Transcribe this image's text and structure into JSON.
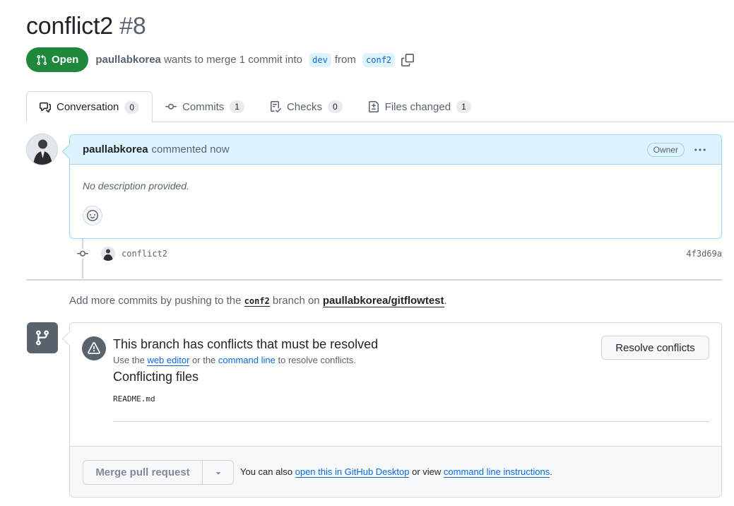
{
  "pr": {
    "title": "conflict2",
    "number": "#8",
    "state": "Open",
    "author": "paullabkorea",
    "merge_text_before": "wants to merge 1 commit into",
    "base_branch": "dev",
    "from_text": "from",
    "head_branch": "conf2"
  },
  "tabs": [
    {
      "label": "Conversation",
      "count": "0",
      "icon": "comment-discussion-icon"
    },
    {
      "label": "Commits",
      "count": "1",
      "icon": "git-commit-icon"
    },
    {
      "label": "Checks",
      "count": "0",
      "icon": "checklist-icon"
    },
    {
      "label": "Files changed",
      "count": "1",
      "icon": "file-diff-icon"
    }
  ],
  "comment": {
    "author": "paullabkorea",
    "action": "commented now",
    "role_badge": "Owner",
    "body": "No description provided."
  },
  "commit": {
    "message": "conflict2",
    "sha": "4f3d69a"
  },
  "push_hint": {
    "before": "Add more commits by pushing to the",
    "branch": "conf2",
    "middle": "branch on",
    "repo": "paullabkorea/gitflowtest",
    "end": "."
  },
  "merge_box": {
    "conflict_title": "This branch has conflicts that must be resolved",
    "sub_before": "Use the",
    "web_editor": "web editor",
    "sub_mid": "or the",
    "command_line": "command line",
    "sub_after": "to resolve conflicts.",
    "files_title": "Conflicting files",
    "files": [
      "README.md"
    ],
    "resolve_label": "Resolve conflicts",
    "merge_label": "Merge pull request",
    "foot_before": "You can also",
    "foot_link1": "open this in GitHub Desktop",
    "foot_mid": "or view",
    "foot_link2": "command line instructions",
    "foot_end": "."
  },
  "colors": {
    "open_green": "#1f883d",
    "link_blue": "#0969da",
    "comment_header_bg": "#ddf4ff",
    "muted_text": "#59636e"
  }
}
